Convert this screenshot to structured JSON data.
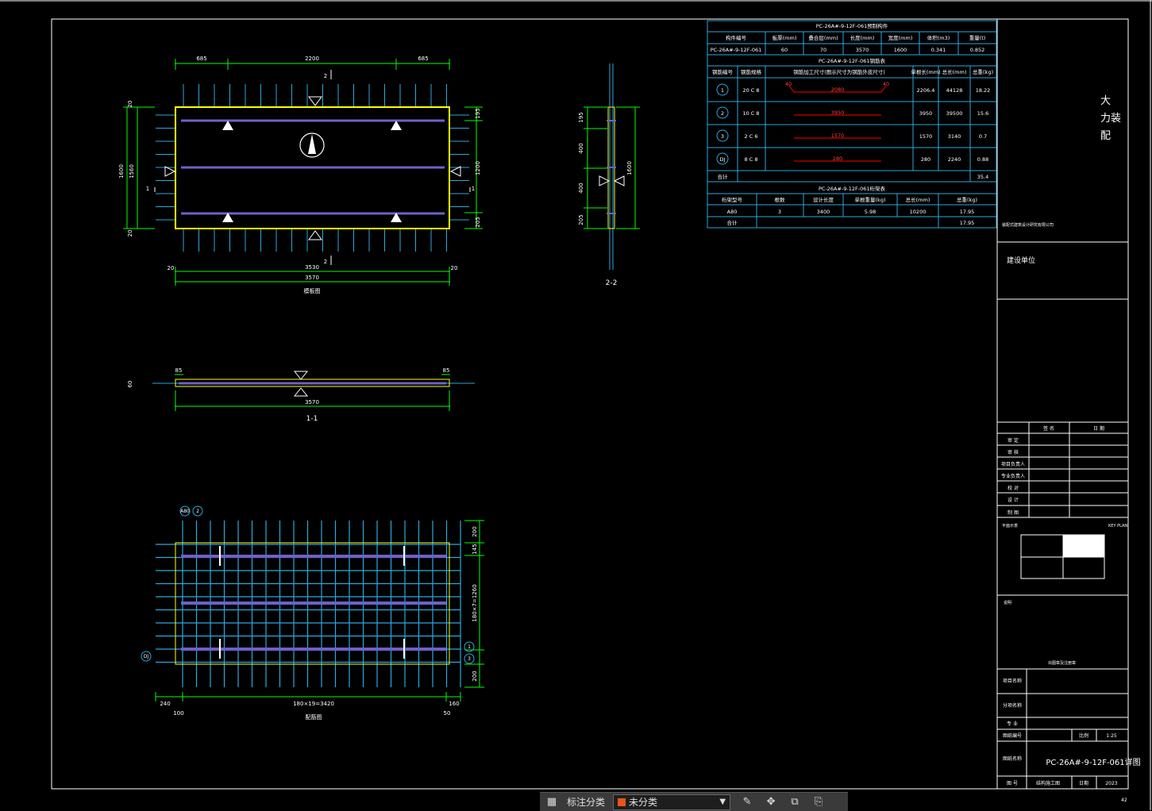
{
  "colors": {
    "frame": "#ffffff",
    "table": "#29a9e0",
    "dim": "#00ff00",
    "bar": "#29a9e0",
    "panel": "#ffff00",
    "rebar": "#7060c8",
    "text": "#ffffff",
    "red": "#ff0000"
  },
  "plan": {
    "top_dims": [
      "685",
      "2200",
      "685"
    ],
    "bottom_dims": [
      "20",
      "3530",
      "20"
    ],
    "overall": "3570",
    "left_dims": [
      "20",
      "1600",
      "1560",
      "20"
    ],
    "right_dims": [
      "195",
      "1200",
      "205"
    ],
    "section_marks": {
      "two_top": "2",
      "two_bot": "2",
      "one_left": "1",
      "one_right": "1"
    },
    "caption": "模板图"
  },
  "section22": {
    "dims": [
      "195",
      "400",
      "400",
      "205"
    ],
    "height": "1600",
    "label": "2-2"
  },
  "section11": {
    "left": "85",
    "right": "85",
    "length": "3570",
    "thick": "60",
    "label": "1-1"
  },
  "rebar_plan": {
    "top_tags": [
      "A80",
      "2"
    ],
    "left_tag": "DJ",
    "right_tags": [
      "1",
      "3"
    ],
    "right_dims": [
      "200",
      "145",
      "180×7=1260",
      "200"
    ],
    "bottom_dims": [
      "240",
      "180×19=3420",
      "160"
    ],
    "bottom_sub": [
      "100",
      "50"
    ],
    "caption": "配筋图"
  },
  "tables": {
    "t1_title": "PC-26A#-9-12F-061预制构件",
    "t1_headers": [
      "构件编号",
      "板厚(mm)",
      "叠合层(mm)",
      "长度(mm)",
      "宽度(mm)",
      "体积(m3)",
      "重量(t)"
    ],
    "t1_row": [
      "PC-26A#-9-12F-061",
      "60",
      "70",
      "3570",
      "1600",
      "0.341",
      "0.852"
    ],
    "t2_title": "PC-26A#-9-12F-061钢筋表",
    "t2_headers": [
      "钢筋编号",
      "钢筋规格",
      "钢筋加工尺寸(图示尺寸为钢筋外皮尺寸)",
      "单根长(mm)",
      "总长(mm)",
      "总重(kg)"
    ],
    "t2_rows": [
      {
        "no": "1",
        "spec": "20 C 8",
        "dim_l": "40",
        "dim": "2080",
        "dim_r": "40",
        "single": "2206.4",
        "total": "44128",
        "weight": "18.22"
      },
      {
        "no": "2",
        "spec": "10 C 8",
        "dim": "3950",
        "single": "3950",
        "total": "39500",
        "weight": "15.6"
      },
      {
        "no": "3",
        "spec": "2 C 6",
        "dim": "1570",
        "single": "1570",
        "total": "3140",
        "weight": "0.7"
      },
      {
        "no": "DJ",
        "spec": "8 C 8",
        "dim": "280",
        "single": "280",
        "total": "2240",
        "weight": "0.88"
      }
    ],
    "t2_total_label": "合计",
    "t2_total": "35.4",
    "t3_title": "PC-26A#-9-12F-061桁架表",
    "t3_headers": [
      "桁架型号",
      "根数",
      "设计长度",
      "单根重量(kg)",
      "总长(mm)",
      "总重(kg)"
    ],
    "t3_row": [
      "A80",
      "3",
      "3400",
      "5.98",
      "10200",
      "17.95"
    ],
    "t3_total_label": "合计",
    "t3_total": "17.95"
  },
  "title_block": {
    "firm": [
      "大",
      "力装",
      "配"
    ],
    "firm_small": "装配式建筑设计研究有限公司",
    "client": "建设单位",
    "sign_headers": [
      "签 名",
      "日 期"
    ],
    "sign_rows": [
      "审 定",
      "审 核",
      "项目负责人",
      "专业负责人",
      "校 对",
      "设 计",
      "制 图"
    ],
    "key_plan": "平面示意",
    "key_plan_note": "KEY PLAN",
    "notes": "说明",
    "seal": "出图章及注册章",
    "project_name": "项目名称",
    "sub_project": "分项名称",
    "profession": "专 业",
    "drawing_no_label": "图纸编号",
    "scale_label": "比例",
    "scale": "1:25",
    "drawing_name_label": "图纸名称",
    "drawing_name": "PC-26A#-9-12F-061详图",
    "no_label": "图 号",
    "no_value": "结构施工图",
    "date_label": "日期",
    "date": "2023",
    "sheet": "42"
  },
  "toolbar": {
    "grid_icon": "grid-icon",
    "label": "标注分类",
    "select_value": "未分类",
    "select_color": "#e8551a",
    "icons": [
      "edit-icon",
      "move-icon",
      "copy-icon",
      "paste-icon"
    ]
  }
}
